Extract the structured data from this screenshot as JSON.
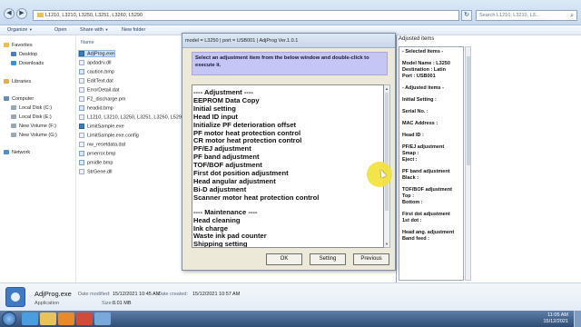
{
  "explorer": {
    "address": "L1210, L3210, L3250, L3251, L3260, L5290",
    "search_placeholder": "Search L1210, L3210, L3...",
    "commands": {
      "organize": "Organize",
      "open": "Open",
      "share": "Share with",
      "new_folder": "New folder"
    },
    "nav": {
      "favorites": "Favorites",
      "desktop": "Desktop",
      "downloads": "Downloads",
      "libraries": "Libraries",
      "computer": "Computer",
      "local_c": "Local Disk (C:)",
      "local_e": "Local Disk (E:)",
      "vol_f": "New Volume (F:)",
      "vol_g": "New Volume (G:)",
      "network": "Network"
    },
    "column_name": "Name",
    "files": [
      "AdjProg.exe",
      "apdadrv.dll",
      "caution.bmp",
      "EditText.dat",
      "ErrorDetail.dat",
      "F2_discharge.pm",
      "headid.bmp",
      "L1210, L3210, L3250, L3251, L3260, L5290",
      "LimitSample.exe",
      "LimitSample.exe.config",
      "nw_resetdata.dat",
      "prnerror.bmp",
      "pmidle.bmp",
      "StrGene.dll"
    ]
  },
  "adjusted": {
    "title": "Adjusted items",
    "lines": [
      "- Selected items -",
      "",
      "Model Name : L3250",
      "Destination : Latin",
      "Port : USB001",
      "",
      "- Adjusted items -",
      "",
      "Initial Setting :",
      "",
      "Serial No. :",
      "",
      "MAC Address :",
      "",
      "Head ID :",
      "",
      "PF/EJ adjustment",
      "  Smap :",
      "  Eject :",
      "",
      "PF band adjustment",
      "  Black :",
      "",
      "TOF/BOF adjustment",
      "  Top :",
      "  Bottom :",
      "",
      "First dot adjustment",
      "  1st dot :",
      "",
      "Head ang. adjustment",
      "  Band feed :"
    ]
  },
  "dialog": {
    "title": "model = L3250 | port = USB001 | AdjProg Ver.1.0.1",
    "instruction": "Select an adjustment item from the below window and double-click to execute it.",
    "items": [
      "---- Adjustment ----",
      "EEPROM Data Copy",
      "Initial setting",
      "Head ID input",
      "Initialize PF deterioration offset",
      "PF motor heat protection control",
      "CR motor heat protection control",
      "PF/EJ adjustment",
      "PF band adjustment",
      "TOF/BOF adjustment",
      "First dot position adjustment",
      "Head angular adjustment",
      "Bi-D adjustment",
      "Scanner motor heat protection control",
      "",
      "---- Maintenance ----",
      "Head cleaning",
      "Ink charge",
      "Waste ink pad counter",
      "Shipping setting"
    ],
    "buttons": {
      "ok": "OK",
      "setting": "Setting",
      "previous": "Previous"
    }
  },
  "details": {
    "name": "AdjProg.exe",
    "type": "Application",
    "modified_label": "Date modified:",
    "modified_value": "15/12/2021 10:45 AM",
    "created_label": "Date created:",
    "created_value": "15/12/2021 10:57 AM",
    "size_label": "Size:",
    "size_value": "8.01 MB"
  },
  "taskbar": {
    "time": "11:05 AM",
    "date": "15/12/2021"
  },
  "colors": {
    "instruction_bg": "#c5c5f6",
    "dialog_bg": "#ece9d8",
    "cursor_highlight": "#f3e23c",
    "taskbar": "#2f4d75"
  }
}
